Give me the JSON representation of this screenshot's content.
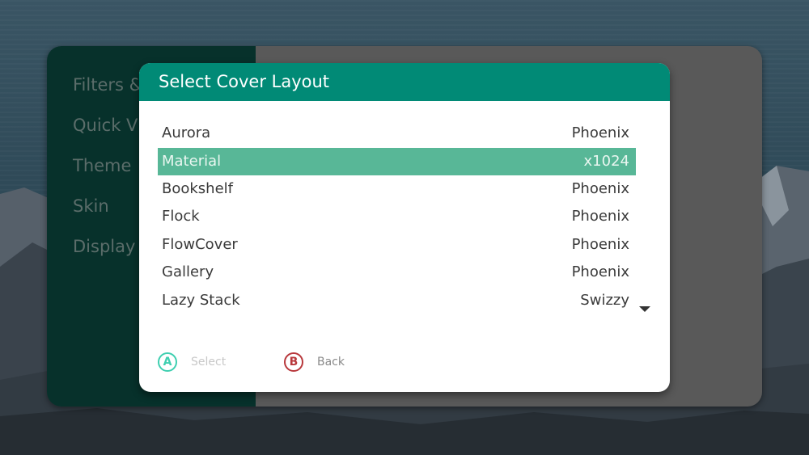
{
  "background_menu": {
    "items": [
      {
        "label": "Filters &"
      },
      {
        "label": "Quick V"
      },
      {
        "label": "Theme"
      },
      {
        "label": "Skin"
      },
      {
        "label": "Display"
      }
    ]
  },
  "dialog": {
    "title": "Select Cover Layout",
    "selected_index": 1,
    "options": [
      {
        "name": "Aurora",
        "author": "Phoenix"
      },
      {
        "name": "Material",
        "author": "x1024"
      },
      {
        "name": "Bookshelf",
        "author": "Phoenix"
      },
      {
        "name": "Flock",
        "author": "Phoenix"
      },
      {
        "name": "FlowCover",
        "author": "Phoenix"
      },
      {
        "name": "Gallery",
        "author": "Phoenix"
      },
      {
        "name": "Lazy Stack",
        "author": "Swizzy"
      }
    ],
    "scroll_indicator_icon": "caret-down-icon",
    "hints": {
      "a_button": {
        "glyph": "A",
        "label": "Select",
        "color": "#3ecfb0"
      },
      "b_button": {
        "glyph": "B",
        "label": "Back",
        "color": "#b8383c"
      }
    }
  },
  "colors": {
    "accent": "#018a76",
    "selection": "#58b797"
  }
}
